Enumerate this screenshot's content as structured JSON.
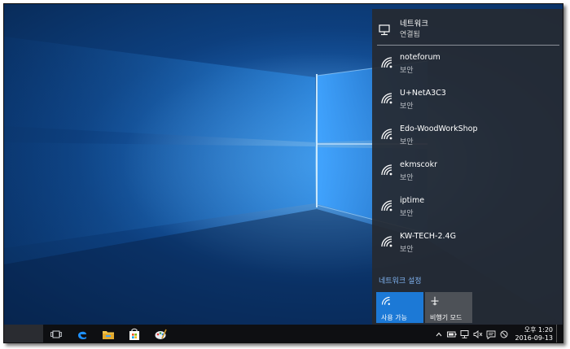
{
  "network_flyout": {
    "header": {
      "title": "네트워크",
      "status": "연결됨",
      "icon": "wired-network-icon"
    },
    "networks": [
      {
        "name": "noteforum",
        "security": "보안"
      },
      {
        "name": "U+NetA3C3",
        "security": "보안"
      },
      {
        "name": "Edo-WoodWorkShop",
        "security": "보안"
      },
      {
        "name": "ekmscokr",
        "security": "보안"
      },
      {
        "name": "iptime",
        "security": "보안"
      },
      {
        "name": "KW-TECH-2.4G",
        "security": "보안"
      }
    ],
    "settings_link": "네트워크 설정",
    "quick_actions": [
      {
        "label": "사용 가능",
        "icon": "wifi-icon",
        "state": "on"
      },
      {
        "label": "비행기 모드",
        "icon": "airplane-icon",
        "state": "off"
      }
    ]
  },
  "taskbar": {
    "apps": [
      {
        "icon": "task-view-icon"
      },
      {
        "icon": "edge-browser-icon"
      },
      {
        "icon": "file-explorer-icon"
      },
      {
        "icon": "store-icon"
      },
      {
        "icon": "paint-app-icon",
        "active": true
      }
    ],
    "tray_icons": [
      "chevron-up-icon",
      "battery-icon",
      "network-icon",
      "volume-mute-icon",
      "action-center-icon",
      "block-icon"
    ],
    "clock": {
      "time": "오후 1:20",
      "date": "2016-09-13"
    }
  },
  "colors": {
    "accent": "#1c79d6",
    "flyout_bg": "#262a31",
    "link": "#7fb2f0"
  }
}
